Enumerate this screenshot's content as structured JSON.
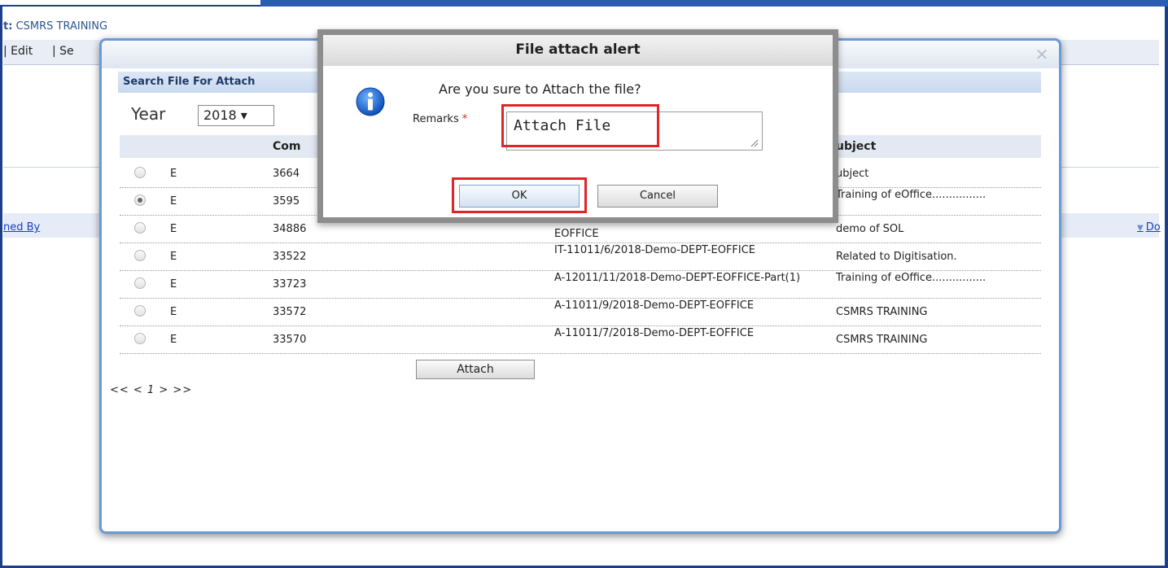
{
  "background": {
    "subject_prefix": "t:",
    "subject": "CSMRS TRAINING",
    "toolbar_items": [
      "| Edit",
      "| Se"
    ],
    "link_left": "ned By",
    "link_right": "Do"
  },
  "search_dialog": {
    "section_title": "Search File For Attach",
    "year_label": "Year",
    "year_value": "2018 ▾",
    "columns": [
      "Com",
      "ubject"
    ],
    "rows": [
      {
        "type": "E",
        "computer_no": "3664",
        "file_no": "",
        "subject": "ubject",
        "selected": false
      },
      {
        "type": "E",
        "computer_no": "3595",
        "file_no": "",
        "subject": "Training of eOffice................",
        "selected": true
      },
      {
        "type": "E",
        "computer_no": "34886",
        "file_no": "EOFFICE",
        "subject": "demo of SOL",
        "selected": false
      },
      {
        "type": "E",
        "computer_no": "33522",
        "file_no": "IT-11011/6/2018-Demo-DEPT-EOFFICE",
        "subject": "Related to Digitisation.",
        "selected": false
      },
      {
        "type": "E",
        "computer_no": "33723",
        "file_no": "A-12011/11/2018-Demo-DEPT-EOFFICE-Part(1)",
        "subject": "Training of eOffice................",
        "selected": false
      },
      {
        "type": "E",
        "computer_no": "33572",
        "file_no": "A-11011/9/2018-Demo-DEPT-EOFFICE",
        "subject": "CSMRS TRAINING",
        "selected": false
      },
      {
        "type": "E",
        "computer_no": "33570",
        "file_no": "A-11011/7/2018-Demo-DEPT-EOFFICE",
        "subject": "CSMRS TRAINING",
        "selected": false
      }
    ],
    "attach_label": "Attach",
    "pager": {
      "prev": "<< <",
      "page": "1",
      "next": "> >>"
    }
  },
  "alert": {
    "title": "File attach alert",
    "question": "Are you sure to Attach the file?",
    "remarks_label": "Remarks",
    "required_mark": "*",
    "remarks_value": "Attach File",
    "ok_label": "OK",
    "cancel_label": "Cancel"
  },
  "colors": {
    "highlight": "#e0242b",
    "frame": "#1c3f8a",
    "link": "#1a3fbf"
  },
  "icons": [
    "info-icon",
    "close-icon",
    "resize-grip-icon",
    "dropdown-arrow-icon"
  ]
}
